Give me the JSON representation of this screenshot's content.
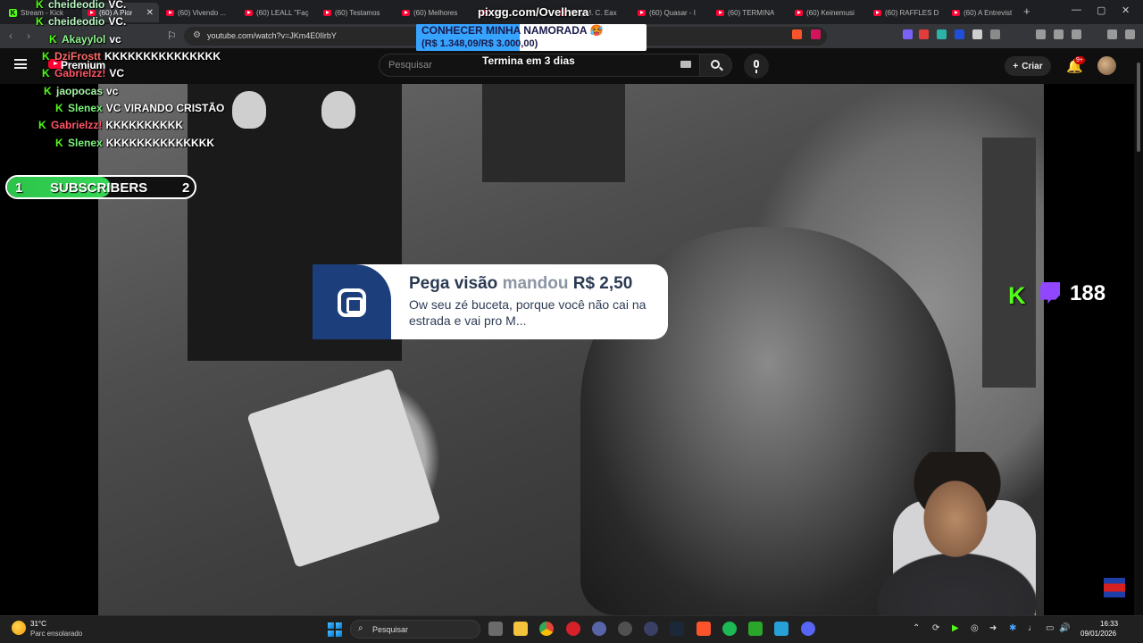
{
  "browser": {
    "tabs": [
      {
        "label": "Stream - Kick",
        "icon": "kick"
      },
      {
        "label": "(60) A Pior",
        "icon": "youtube",
        "active": true
      },
      {
        "label": "(60) Vivendo ... ",
        "icon": "youtube"
      },
      {
        "label": "(60) LEALL \"Faç",
        "icon": "youtube"
      },
      {
        "label": "(60) Testamos",
        "icon": "youtube"
      },
      {
        "label": "(60) Melhores",
        "icon": "youtube"
      },
      {
        "label": "(60) ...",
        "icon": "youtube"
      },
      {
        "label": "(60) M. C. Eax",
        "icon": "youtube"
      },
      {
        "label": "(60) Quasar - I",
        "icon": "youtube"
      },
      {
        "label": "(60) TERMINA",
        "icon": "youtube"
      },
      {
        "label": "(60) Keinemusi",
        "icon": "youtube"
      },
      {
        "label": "(60) RAFFLES D",
        "icon": "youtube"
      },
      {
        "label": "(60) A Entrevist",
        "icon": "youtube"
      }
    ],
    "url": "youtube.com/watch?v=JKm4E0IlrbY",
    "new_tab_label": "+",
    "window_controls": {
      "minimize": "—",
      "maximize": "▢",
      "close": "✕"
    }
  },
  "youtube": {
    "brand": "Premium",
    "search_placeholder": "Pesquisar",
    "create_label": "Criar",
    "notifications_badge": "9+"
  },
  "stream_overlay": {
    "site": "pixgg.com/Ovelhera",
    "goal": {
      "title": "CONHECER MINHA NAMORADA 🥵",
      "progress_text": "(R$ 1.348,09/R$ 3.000,00)",
      "current": 1348.09,
      "target": 3000.0,
      "ends_in": "Termina em 3 dias"
    },
    "subscribers": {
      "start": "1",
      "label": "SUBSCRIBERS",
      "end": "2",
      "progress": 0.55
    },
    "donation": {
      "name": "Pega visão",
      "verb": "mandou",
      "amount": "R$ 2,50",
      "message": "Ow seu zé buceta, porque você não cai na estrada e vai pro M..."
    },
    "viewers": "188",
    "chat": [
      {
        "user": "cheideodio",
        "msg": "VC.",
        "color": "#b8f7c2"
      },
      {
        "user": "cheideodio",
        "msg": "VC.",
        "color": "#b8f7c2"
      },
      {
        "user": "Akayylol",
        "msg": "vc",
        "color": "#8ef58f"
      },
      {
        "user": "DziFrostt",
        "msg": "KKKKKKKKKKKKKKK",
        "color": "#ff6b6b"
      },
      {
        "user": "Gabrielzz!",
        "msg": "VC",
        "color": "#ff5566"
      },
      {
        "user": "jaopocas",
        "msg": "vc",
        "color": "#a6f2a6"
      },
      {
        "user": "Slenex",
        "msg": "VC VIRANDO CRISTÃO",
        "color": "#7cf27c"
      },
      {
        "user": "Gabrielzz!",
        "msg": "KKKKKKKKKK",
        "color": "#ff5566"
      },
      {
        "user": "Slenex",
        "msg": "KKKKKKKKKKKKKK",
        "color": "#7cf27c"
      }
    ]
  },
  "taskbar": {
    "weather_temp": "31°C",
    "weather_desc": "Parc ensolarado",
    "search_label": "Pesquisar",
    "time": "16:33",
    "date": "09/01/2026"
  },
  "colors": {
    "kick_green": "#53fc18",
    "twitch_purple": "#9146ff",
    "youtube_red": "#ff0033",
    "donation_navy": "#1c3e7a",
    "goal_blue": "#36a3ff"
  }
}
